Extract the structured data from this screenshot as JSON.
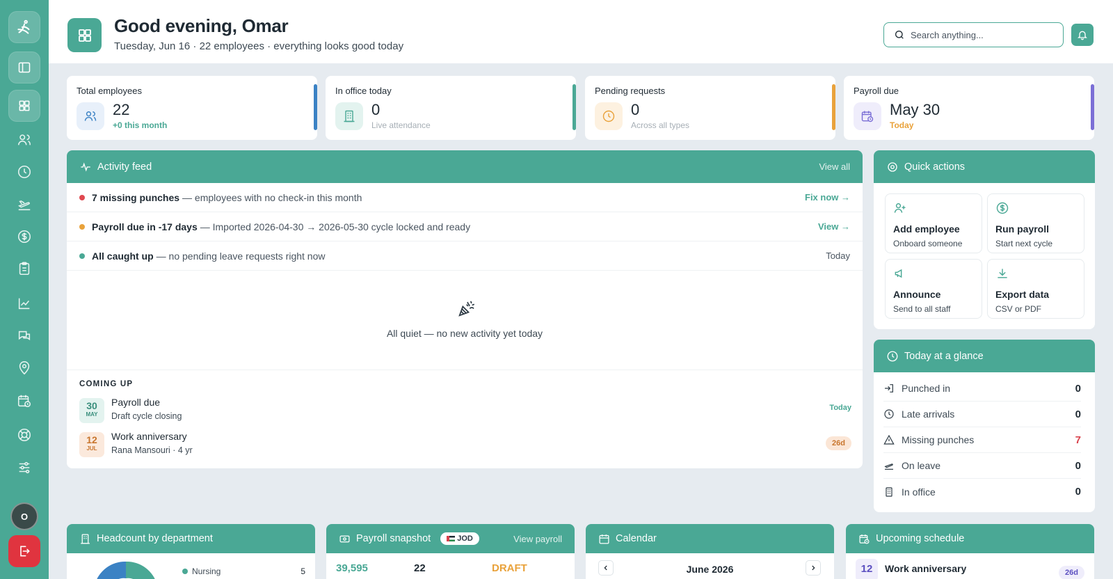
{
  "header": {
    "greeting": "Good evening, Omar",
    "subtitle": "Tuesday, Jun 16 · 22 employees · everything looks good today",
    "search_placeholder": "Search anything..."
  },
  "sidebar": {
    "avatar_initial": "O",
    "items": [
      "logo",
      "toggle-sidebar",
      "dashboard",
      "employees",
      "attendance",
      "leave",
      "payroll",
      "requests",
      "reports",
      "messages",
      "locations",
      "schedule",
      "support",
      "settings"
    ]
  },
  "stats": [
    {
      "label": "Total employees",
      "value": "22",
      "sub": "+0 this month",
      "icon": "users-icon",
      "accent": "#3b82c4"
    },
    {
      "label": "In office today",
      "value": "0",
      "sub": "Live attendance",
      "icon": "building-icon",
      "accent": "#4aa895"
    },
    {
      "label": "Pending requests",
      "value": "0",
      "sub": "Across all types",
      "icon": "clock-icon",
      "accent": "#e9a23b"
    },
    {
      "label": "Payroll due",
      "value": "May 30",
      "sub": "Today",
      "icon": "calendar-clock-icon",
      "accent": "#7b6fd6"
    }
  ],
  "activity": {
    "title": "Activity feed",
    "view_all": "View all",
    "rows": [
      {
        "bold": "7 missing punches",
        "rest": "— employees with no check-in this month",
        "action": "Fix now →",
        "dot": "#e0484f"
      },
      {
        "bold": "Payroll due in -17 days",
        "rest": "— Imported 2026-04-30 → 2026-05-30 cycle locked and ready",
        "action": "View →",
        "dot": "#e9a23b"
      },
      {
        "bold": "All caught up",
        "rest": "— no pending leave requests right now",
        "action": "Today",
        "dot": "#4aa895"
      }
    ],
    "quiet_text": "All quiet — no new activity yet today",
    "coming_up_label": "COMING UP",
    "coming_up": [
      {
        "day": "30",
        "month": "MAY",
        "title": "Payroll due",
        "sub": "Draft cycle closing",
        "badge": "Today"
      },
      {
        "day": "12",
        "month": "JUL",
        "title": "Work anniversary",
        "sub": "Rana Mansouri · 4 yr",
        "badge": "26d"
      }
    ]
  },
  "quick_actions": {
    "title": "Quick actions",
    "items": [
      {
        "title": "Add employee",
        "sub": "Onboard someone",
        "icon": "user-plus-icon"
      },
      {
        "title": "Run payroll",
        "sub": "Start next cycle",
        "icon": "dollar-circle-icon"
      },
      {
        "title": "Announce",
        "sub": "Send to all staff",
        "icon": "megaphone-icon"
      },
      {
        "title": "Export data",
        "sub": "CSV or PDF",
        "icon": "download-icon"
      }
    ]
  },
  "glance": {
    "title": "Today at a glance",
    "rows": [
      {
        "label": "Punched in",
        "value": "0",
        "icon": "login-icon"
      },
      {
        "label": "Late arrivals",
        "value": "0",
        "icon": "clock-icon"
      },
      {
        "label": "Missing punches",
        "value": "7",
        "icon": "warning-icon"
      },
      {
        "label": "On leave",
        "value": "0",
        "icon": "plane-icon"
      },
      {
        "label": "In office",
        "value": "0",
        "icon": "building-icon"
      }
    ]
  },
  "bottom": {
    "headcount": {
      "title": "Headcount by department",
      "dept": "Nursing",
      "count": "5"
    },
    "payroll": {
      "title": "Payroll snapshot",
      "currency": "JOD",
      "link": "View payroll",
      "amount": "39,595",
      "employees": "22",
      "status": "DRAFT"
    },
    "calendar": {
      "title": "Calendar",
      "month": "June 2026"
    },
    "schedule": {
      "title": "Upcoming schedule",
      "day": "12",
      "event": "Work anniversary",
      "badge": "26d"
    }
  }
}
